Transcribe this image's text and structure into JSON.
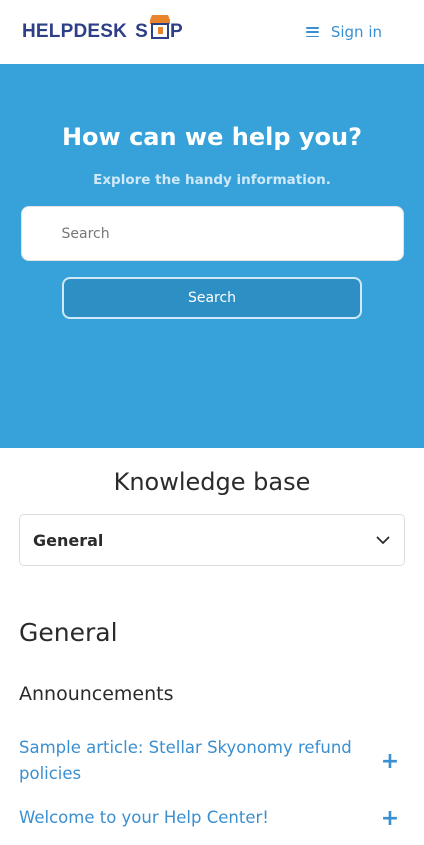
{
  "header": {
    "logo_part1": "HELPDESK",
    "logo_part2_s": "S",
    "logo_part2_p": "P",
    "signin_label": "Sign in"
  },
  "hero": {
    "title": "How can we help you?",
    "subtitle": "Explore the handy information.",
    "search_placeholder": "Search",
    "search_button_label": "Search"
  },
  "knowledge_base": {
    "title": "Knowledge base",
    "selected_category": "General",
    "section_title": "General",
    "subsection_title": "Announcements",
    "articles": [
      {
        "title": "Sample article: Stellar Skyonomy refund policies"
      },
      {
        "title": "Welcome to your Help Center!"
      }
    ]
  },
  "colors": {
    "brand_blue": "#2d3f86",
    "accent_orange": "#e8842b",
    "hero_bg": "#36a2d9",
    "link_blue": "#3a8fd0"
  },
  "icons": {
    "menu": "hamburger-icon",
    "select": "chevron-down-icon",
    "expand": "plus-icon"
  }
}
